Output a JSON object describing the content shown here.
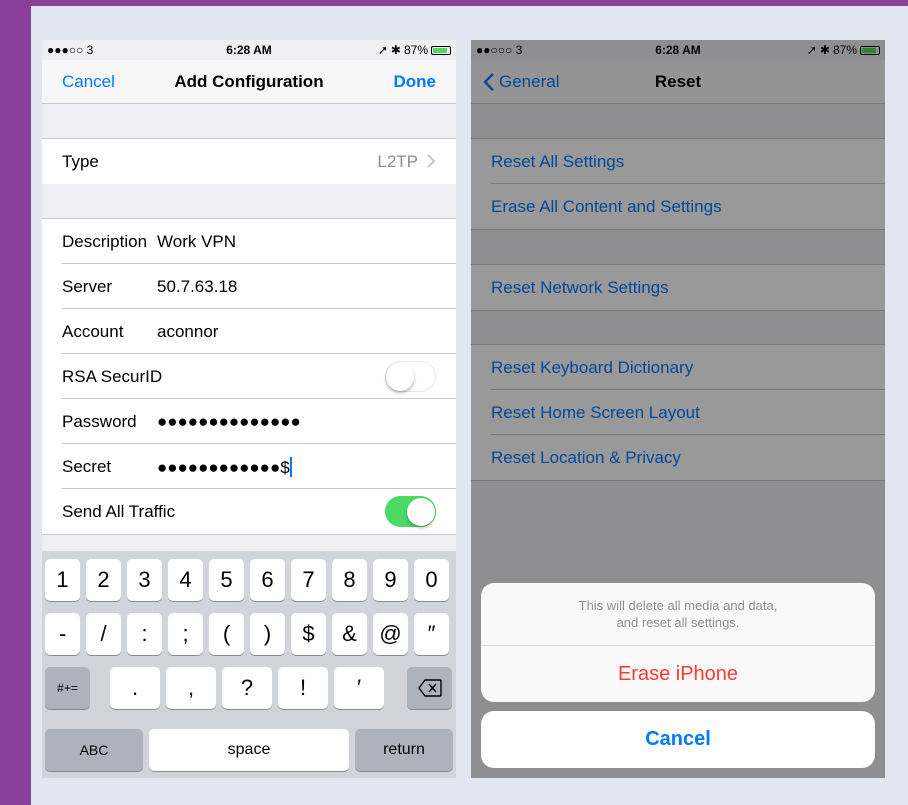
{
  "colors": {
    "background": "#8a3f9a",
    "ios_blue": "#007aff",
    "destructive_red": "#ff3b30",
    "toggle_green": "#4cd964"
  },
  "left": {
    "status": {
      "carrier": "●●●○○ 3",
      "time": "6:28 AM",
      "battery": "87%"
    },
    "nav": {
      "cancel": "Cancel",
      "title": "Add Configuration",
      "done": "Done"
    },
    "type_row": {
      "label": "Type",
      "value": "L2TP"
    },
    "fields": {
      "description": {
        "label": "Description",
        "value": "Work VPN"
      },
      "server": {
        "label": "Server",
        "value": "50.7.63.18"
      },
      "account": {
        "label": "Account",
        "value": "aconnor"
      },
      "rsa": {
        "label": "RSA SecurID",
        "on": false
      },
      "password": {
        "label": "Password",
        "value": "●●●●●●●●●●●●●●"
      },
      "secret": {
        "label": "Secret",
        "value": "●●●●●●●●●●●●$"
      },
      "send_all": {
        "label": "Send All Traffic",
        "on": true
      }
    },
    "keyboard": {
      "row1": [
        "1",
        "2",
        "3",
        "4",
        "5",
        "6",
        "7",
        "8",
        "9",
        "0"
      ],
      "row2": [
        "-",
        "/",
        ":",
        ";",
        "(",
        ")",
        "$",
        "&",
        "@",
        "″"
      ],
      "row3": {
        "mode": "#+=",
        "keys": [
          ".",
          ",",
          "?",
          "!",
          "′"
        ]
      },
      "row4": {
        "abc": "ABC",
        "space": "space",
        "return": "return"
      }
    }
  },
  "right": {
    "status": {
      "carrier": "●●○○○ 3",
      "time": "6:28 AM",
      "battery": "87%"
    },
    "nav": {
      "back": "General",
      "title": "Reset"
    },
    "group1": [
      "Reset All Settings",
      "Erase All Content and Settings"
    ],
    "group2": [
      "Reset Network Settings"
    ],
    "group3": [
      "Reset Keyboard Dictionary",
      "Reset Home Screen Layout",
      "Reset Location & Privacy"
    ],
    "sheet": {
      "message_line1": "This will delete all media and data,",
      "message_line2": "and reset all settings.",
      "erase": "Erase iPhone",
      "cancel": "Cancel"
    }
  }
}
